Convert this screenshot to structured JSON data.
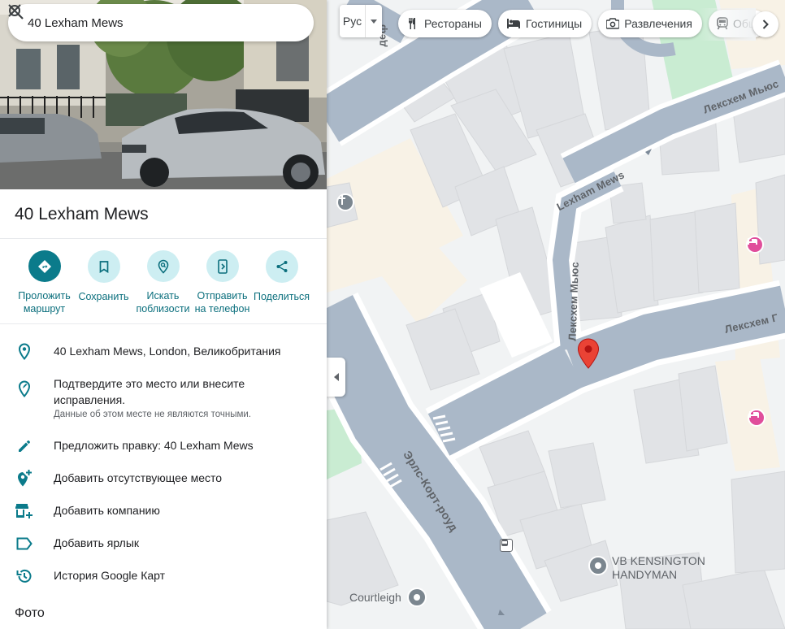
{
  "search": {
    "value": "40 Lexham Mews"
  },
  "place": {
    "title": "40 Lexham Mews"
  },
  "actions": [
    {
      "label_line1": "Проложить",
      "label_line2": "маршрут"
    },
    {
      "label_line1": "Сохранить",
      "label_line2": ""
    },
    {
      "label_line1": "Искать",
      "label_line2": "поблизости"
    },
    {
      "label_line1": "Отправить",
      "label_line2": "на телефон"
    },
    {
      "label_line1": "Поделиться",
      "label_line2": ""
    }
  ],
  "info": {
    "address": "40 Lexham Mews, London, Великобритания",
    "verify_line1": "Подтвердите это место или внесите",
    "verify_line2": "исправления.",
    "verify_sub": "Данные об этом месте не являются точными.",
    "suggest_edit": "Предложить правку: 40 Lexham Mews",
    "add_missing": "Добавить отсутствующее место",
    "add_business": "Добавить компанию",
    "add_label": "Добавить ярлык",
    "history": "История Google Карт"
  },
  "photos_heading": "Фото",
  "map": {
    "layer_label": "Рус",
    "chips": [
      "Рестораны",
      "Гостиницы",
      "Развлечения",
      "Общ"
    ],
    "streets": {
      "lexham_mews_top": "Лексхем Мьюс",
      "lexham_mews_en": "Lexham Mews",
      "lexham_mews_vertical": "Лексхем Мьюс",
      "lexham_gardens": "Лексхем Г",
      "earls_court": "Эрлс-Корт-роуд",
      "top_fragment": "деф"
    },
    "pois": {
      "handyman_line1": "VB KENSINGTON",
      "handyman_line2": "HANDYMAN",
      "courtleigh": "Courtleigh"
    }
  },
  "colors": {
    "accent": "#0b7b8b",
    "road": "#aab8c8",
    "building": "#e3e4e6",
    "park": "#c9ecd2",
    "pin": "#ea4335"
  }
}
